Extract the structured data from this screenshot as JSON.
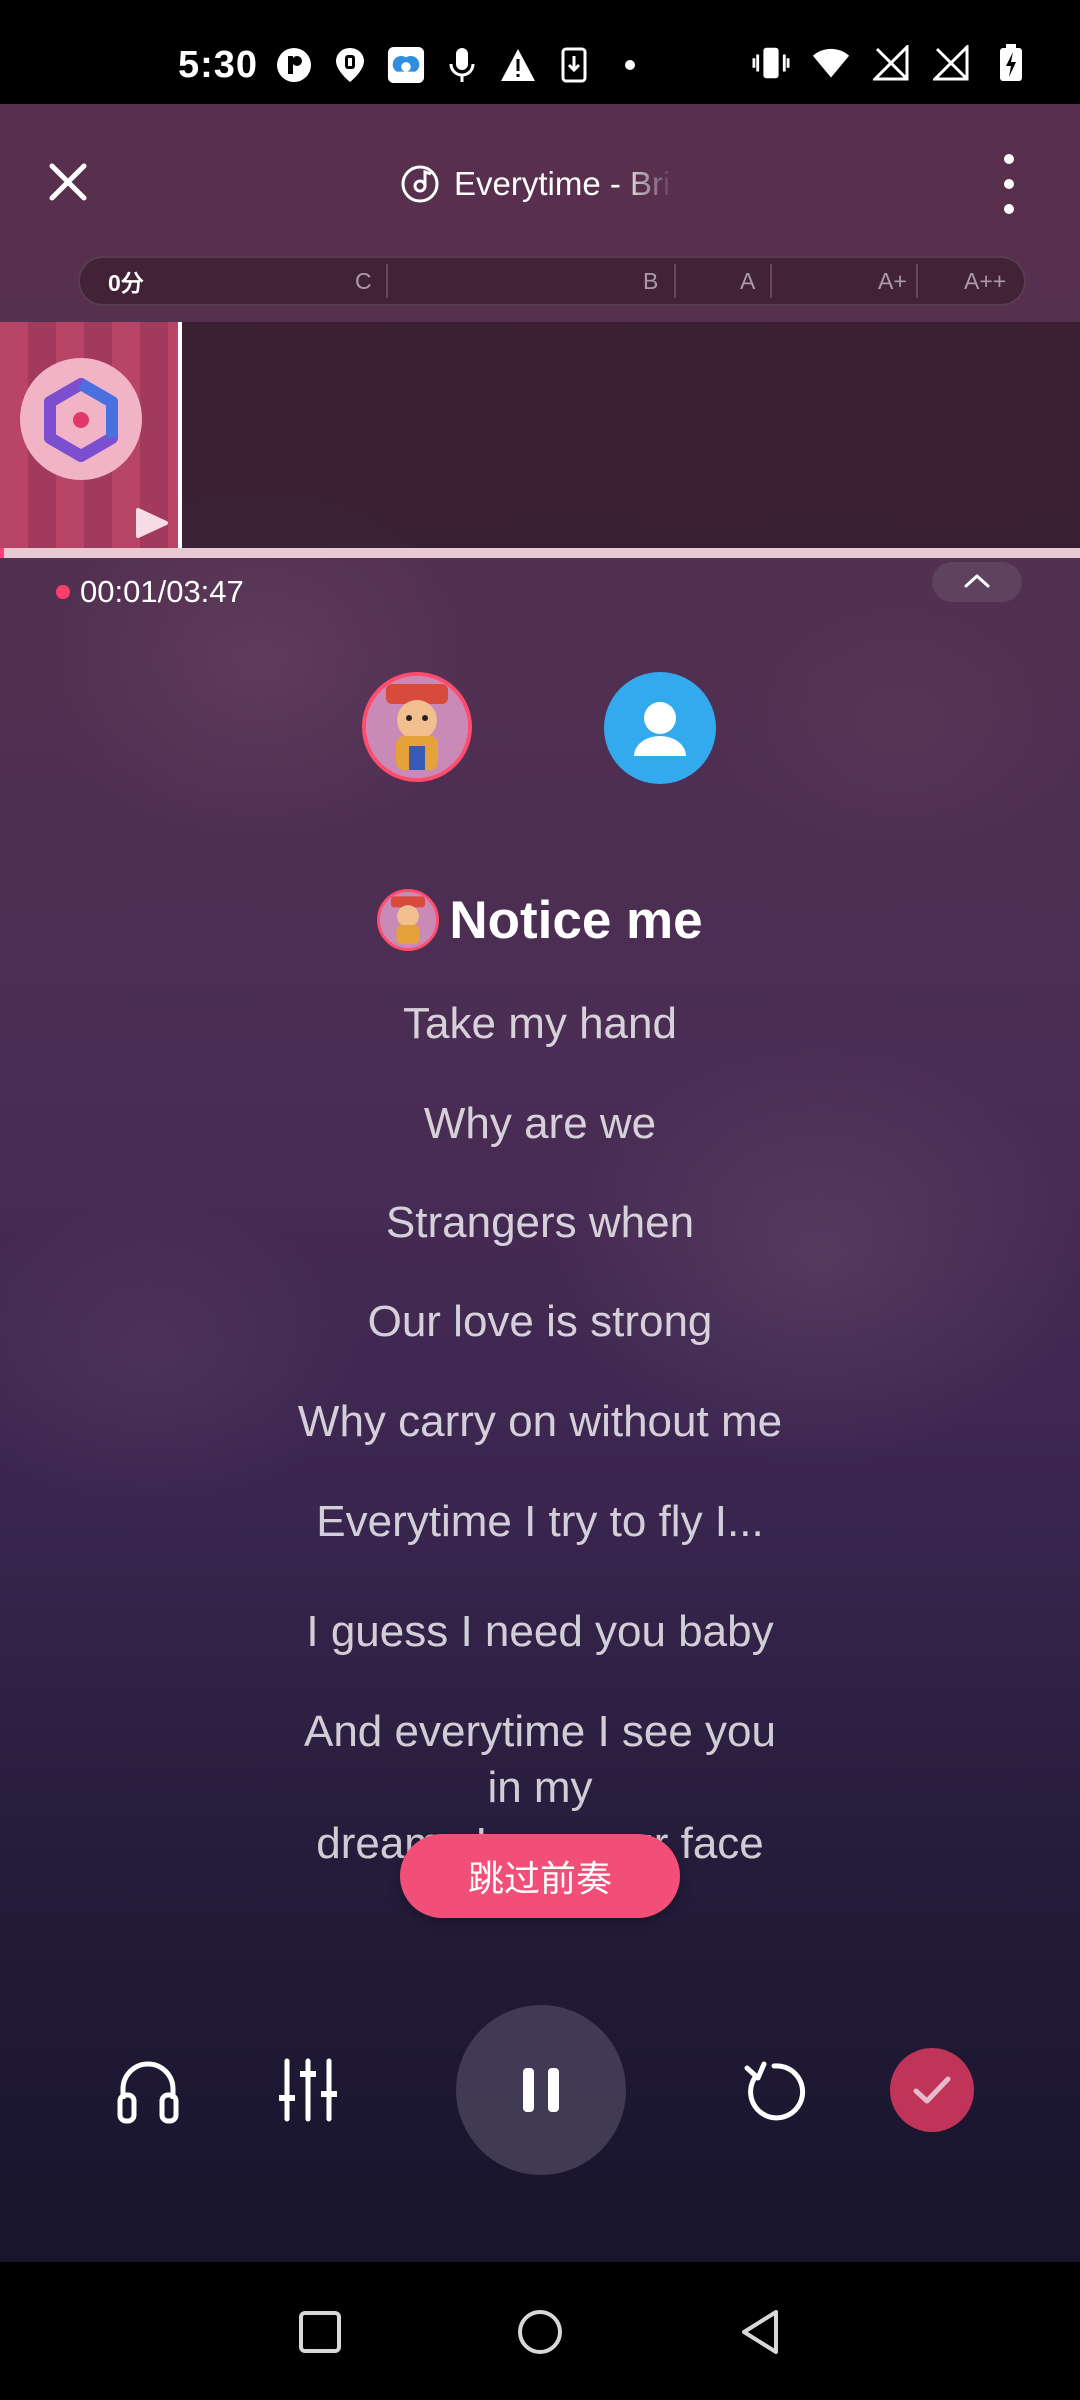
{
  "status_bar": {
    "time": "5:30"
  },
  "header": {
    "song_title": "Everytime - Britney Spears",
    "close_icon": "close-icon",
    "more_icon": "more-vertical-icon"
  },
  "score_bar": {
    "current_score": "0分",
    "grades": [
      "C",
      "B",
      "A",
      "A+",
      "A++"
    ]
  },
  "playback": {
    "elapsed": "00:01",
    "separator": "/",
    "total": "03:47",
    "progress_fraction": 0.004
  },
  "lyrics": {
    "current": "Notice me",
    "upcoming": [
      "Take my hand",
      "Why are we",
      "Strangers when",
      "Our love is strong",
      "Why carry on without me",
      "Everytime I try to fly I...",
      "I guess I need you baby",
      "And everytime I see you",
      "in my",
      "dreams I see your face"
    ]
  },
  "skip_intro_label": "跳过前奏",
  "colors": {
    "accent": "#f24f78",
    "done": "#c1345a",
    "avatar_b": "#33aaee"
  }
}
